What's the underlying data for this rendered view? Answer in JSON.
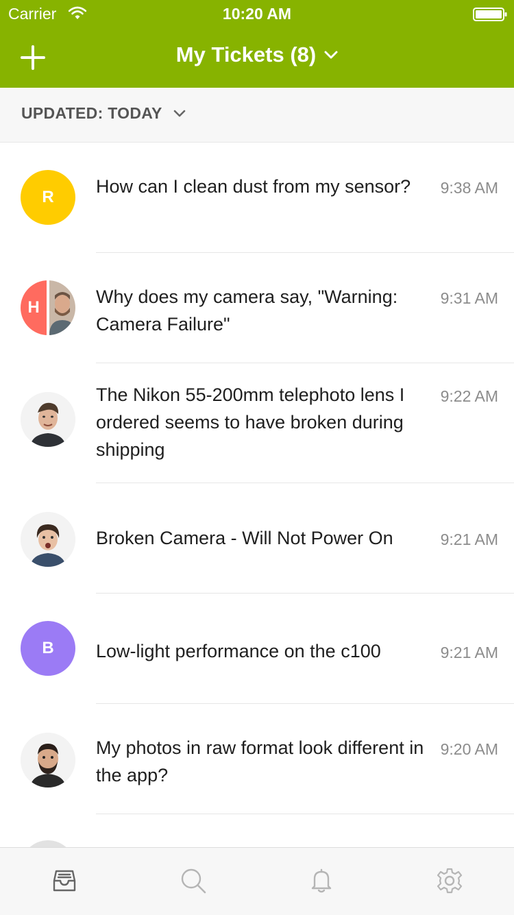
{
  "status_bar": {
    "carrier": "Carrier",
    "time": "10:20 AM"
  },
  "header": {
    "title": "My Tickets (8)"
  },
  "filter": {
    "label": "UPDATED: TODAY"
  },
  "tickets": [
    {
      "initial": "R",
      "avatar_color": "#ffcc00",
      "subject": "How can I clean dust from my sensor?",
      "time": "9:38 AM"
    },
    {
      "initial": "H",
      "avatar_color": "#ff6b5f",
      "subject": "Why does my camera say, \"Warning: Camera Failure\"",
      "time": "9:31 AM"
    },
    {
      "initial": "",
      "avatar_color": "",
      "subject": "The Nikon 55-200mm telephoto lens I ordered seems to have broken during shipping",
      "time": "9:22 AM"
    },
    {
      "initial": "",
      "avatar_color": "",
      "subject": "Broken Camera - Will Not Power On",
      "time": "9:21 AM"
    },
    {
      "initial": "B",
      "avatar_color": "#9b7bf5",
      "subject": "Low-light performance on the c100",
      "time": "9:21 AM"
    },
    {
      "initial": "",
      "avatar_color": "",
      "subject": "My photos in raw format look different in the app?",
      "time": "9:20 AM"
    }
  ],
  "tabs": [
    "inbox-icon",
    "search-icon",
    "bell-icon",
    "gear-icon"
  ],
  "colors": {
    "accent": "#87b300",
    "tab_icon": "#b5b5b5",
    "tab_icon_active": "#666666"
  }
}
